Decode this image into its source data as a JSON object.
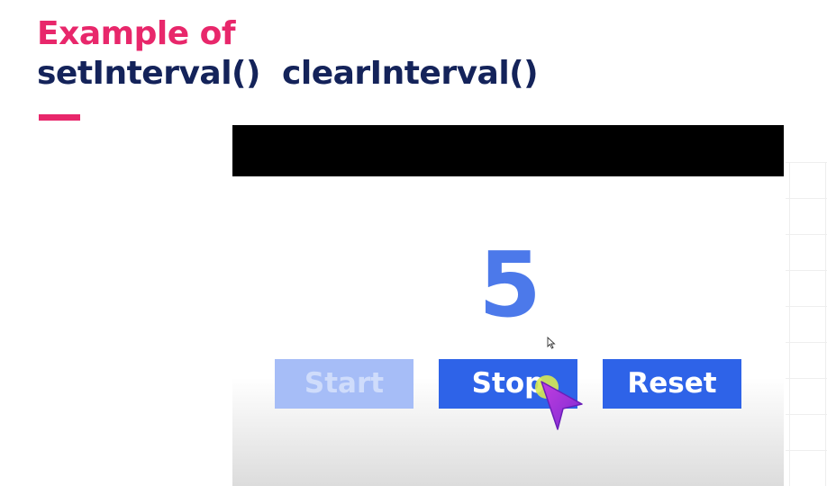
{
  "slide": {
    "title_line_1": "Example of",
    "title_line_2": "setInterval()  clearInterval()"
  },
  "demo": {
    "counter_value": "5",
    "buttons": {
      "start": "Start",
      "stop": "Stop",
      "reset": "Reset"
    },
    "start_disabled": true
  },
  "colors": {
    "title_accent": "#e8276b",
    "title_primary": "#14235a",
    "counter": "#4c79ea",
    "button": "#2e63e8",
    "button_disabled": "#a6bdf7",
    "cursor": "#a633e0",
    "click_highlight": "#d6e854"
  },
  "icons": {
    "cursor": "pointer-arrow-icon",
    "small_pointer": "mouse-pointer-icon"
  }
}
